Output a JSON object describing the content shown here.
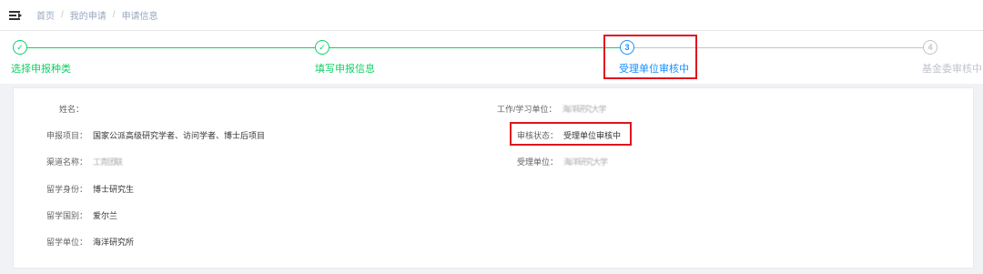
{
  "breadcrumb": {
    "items": [
      "首页",
      "我的申请",
      "申请信息"
    ],
    "separator": "/"
  },
  "steps": [
    {
      "index": "1",
      "title": "选择申报种类",
      "status": "done"
    },
    {
      "index": "2",
      "title": "填写申报信息",
      "status": "done"
    },
    {
      "index": "3",
      "title": "受理单位审核中",
      "status": "active"
    },
    {
      "index": "4",
      "title": "基金委审核中",
      "status": "wait"
    }
  ],
  "check_glyph": "✓",
  "form": {
    "left": [
      {
        "label": "姓名：",
        "value": ""
      },
      {
        "label": "申报项目：",
        "value": "国家公派高级研究学者、访问学者、博士后项目"
      },
      {
        "label": "渠道名称：",
        "value": "工青团联"
      },
      {
        "label": "留学身份：",
        "value": "博士研究生"
      },
      {
        "label": "留学国别：",
        "value": "爱尔兰"
      },
      {
        "label": "留学单位：",
        "value": "海洋研究所"
      }
    ],
    "right": [
      {
        "label": "工作/学习单位：",
        "value": "海洋研究大学"
      },
      {
        "label": "审核状态：",
        "value": "受理单位审核中"
      },
      {
        "label": "受理单位：",
        "value": "海洋研究大学"
      }
    ]
  },
  "colors": {
    "done": "#13ce66",
    "active": "#1890ff",
    "wait": "#c0c4cc",
    "highlight": "#e0141e"
  }
}
